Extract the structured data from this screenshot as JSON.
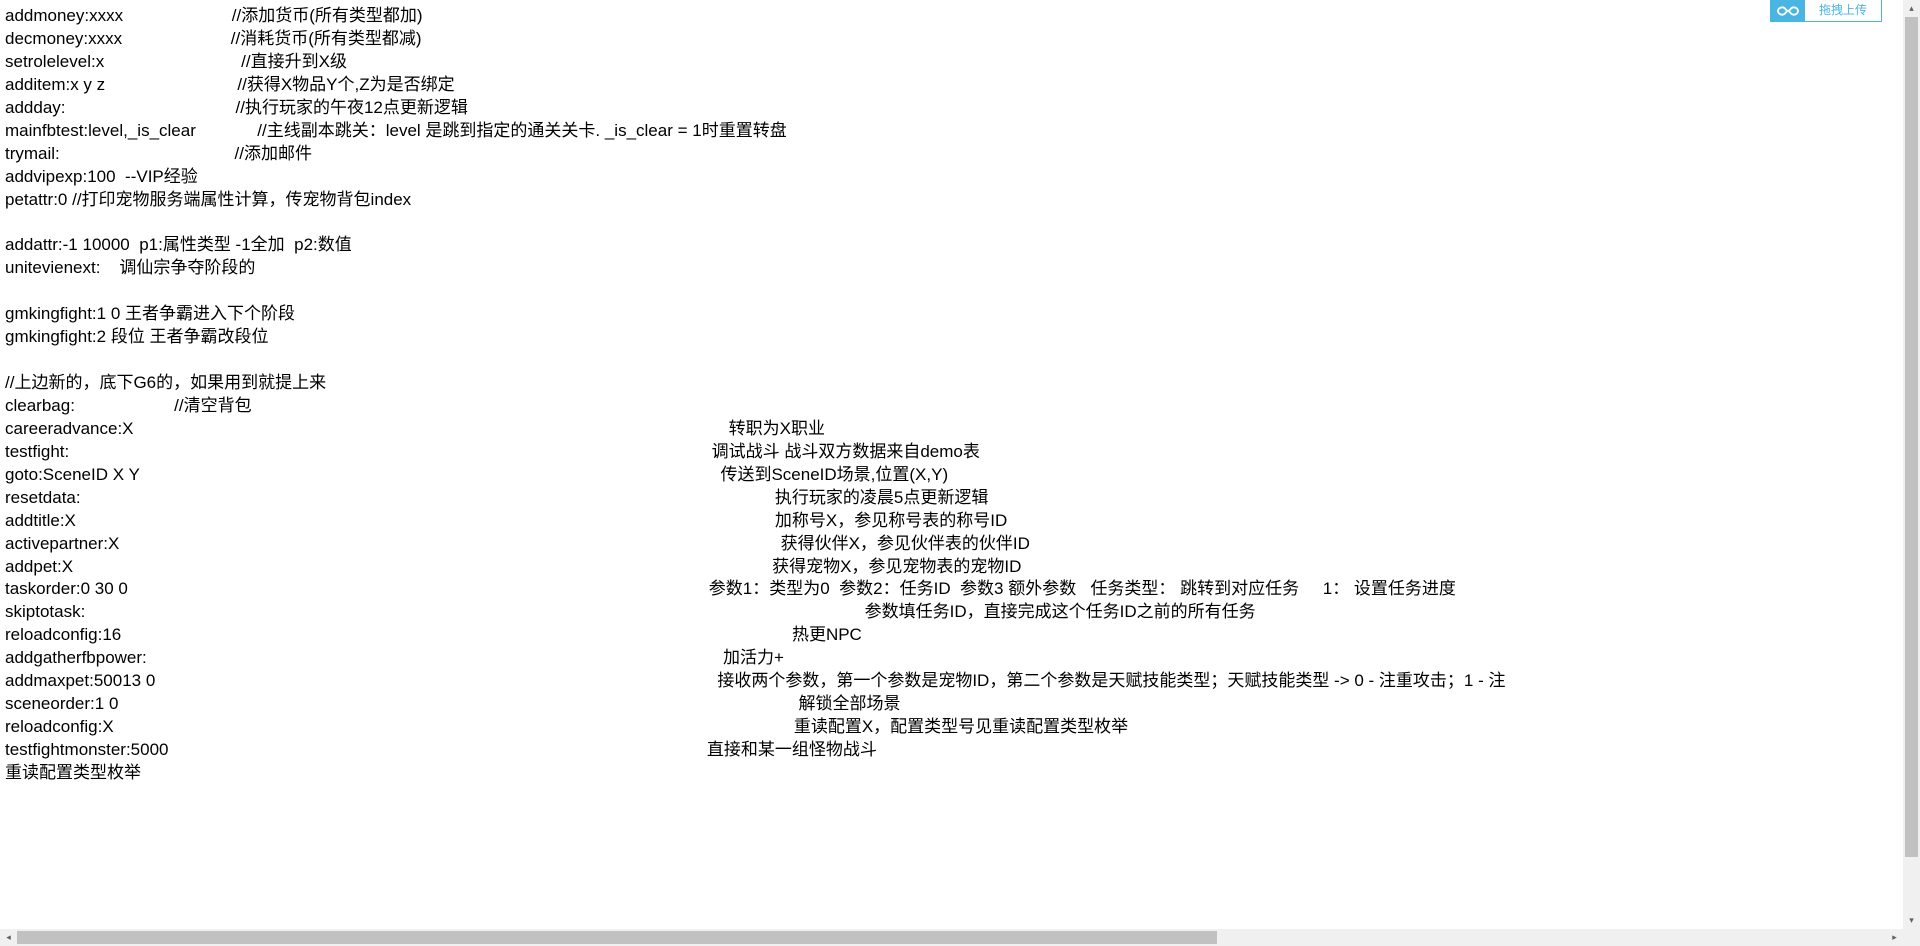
{
  "upload": {
    "label": "拖拽上传"
  },
  "lines": [
    "addmoney:xxxx                       //添加货币(所有类型都加)",
    "decmoney:xxxx                       //消耗货币(所有类型都减)",
    "setrolelevel:x                             //直接升到X级",
    "additem:x y z                            //获得X物品Y个,Z为是否绑定",
    "addday:                                    //执行玩家的午夜12点更新逻辑",
    "mainfbtest:level,_is_clear             //主线副本跳关：level 是跳到指定的通关关卡. _is_clear = 1时重置转盘",
    "trymail:                                     //添加邮件",
    "addvipexp:100  --VIP经验",
    "petattr:0 //打印宠物服务端属性计算，传宠物背包index",
    "",
    "addattr:-1 10000  p1:属性类型 -1全加  p2:数值",
    "unitevienext:    调仙宗争夺阶段的",
    "",
    "gmkingfight:1 0 王者争霸进入下个阶段",
    "gmkingfight:2 段位 王者争霸改段位",
    "",
    "//上边新的，底下G6的，如果用到就提上来",
    "clearbag:                     //清空背包",
    "careeradvance:X                                                                                                                              转职为X职业",
    "testfight:                                                                                                                                        调试战斗 战斗双方数据来自demo表",
    "goto:SceneID X Y                                                                                                                           传送到SceneID场景,位置(X,Y)",
    "resetdata:                                                                                                                                                   执行玩家的凌晨5点更新逻辑",
    "addtitle:X                                                                                                                                                    加称号X，参见称号表的称号ID",
    "activepartner:X                                                                                                                                            获得伙伴X，参见伙伴表的伙伴ID",
    "addpet:X                                                                                                                                                    获得宠物X，参见宠物表的宠物ID",
    "taskorder:0 30 0                                                                                                                           参数1：类型为0  参数2：任务ID  参数3 额外参数   任务类型： 跳转到对应任务     1： 设置任务进度",
    "skiptotask:                                                                                                                                                                     参数填任务ID，直接完成这个任务ID之前的所有任务",
    "reloadconfig:16                                                                                                                                              热更NPC",
    "addgatherfbpower:                                                                                                                          加活力+",
    "addmaxpet:50013 0                                                                                                                       接收两个参数，第一个参数是宠物ID，第二个参数是天赋技能类型；天赋技能类型 -> 0 - 注重攻击；1 - 注",
    "sceneorder:1 0                                                                                                                                                解锁全部场景",
    "reloadconfig:X                                                                                                                                                重读配置X，配置类型号见重读配置类型枚举",
    "testfightmonster:5000                                                                                                                  直接和某一组怪物战斗",
    "重读配置类型枚举"
  ]
}
